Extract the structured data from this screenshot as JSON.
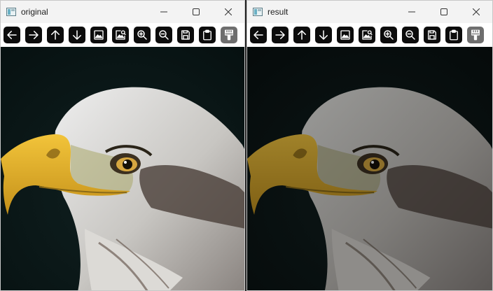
{
  "windows": [
    {
      "title": "original",
      "filter": "none",
      "controls": [
        "minimize-icon",
        "maximize-icon",
        "close-icon"
      ],
      "toolbar": [
        {
          "name": "back-button",
          "icon": "arrow-left-icon"
        },
        {
          "name": "forward-button",
          "icon": "arrow-right-icon"
        },
        {
          "name": "up-button",
          "icon": "arrow-up-icon"
        },
        {
          "name": "down-button",
          "icon": "arrow-down-icon"
        },
        {
          "name": "image-button",
          "icon": "image-icon"
        },
        {
          "name": "image-zoom-button",
          "icon": "image-search-icon"
        },
        {
          "name": "zoom-in-button",
          "icon": "zoom-in-icon"
        },
        {
          "name": "zoom-out-button",
          "icon": "zoom-out-icon"
        },
        {
          "name": "save-button",
          "icon": "save-icon"
        },
        {
          "name": "clipboard-button",
          "icon": "clipboard-icon"
        },
        {
          "name": "properties-button",
          "icon": "brush-icon",
          "selected": true
        }
      ]
    },
    {
      "title": "result",
      "filter": "dim",
      "controls": [
        "minimize-icon",
        "maximize-icon",
        "close-icon"
      ],
      "toolbar": [
        {
          "name": "back-button",
          "icon": "arrow-left-icon"
        },
        {
          "name": "forward-button",
          "icon": "arrow-right-icon"
        },
        {
          "name": "up-button",
          "icon": "arrow-up-icon"
        },
        {
          "name": "down-button",
          "icon": "arrow-down-icon"
        },
        {
          "name": "image-button",
          "icon": "image-icon"
        },
        {
          "name": "image-zoom-button",
          "icon": "image-search-icon"
        },
        {
          "name": "zoom-in-button",
          "icon": "zoom-in-icon"
        },
        {
          "name": "zoom-out-button",
          "icon": "zoom-out-icon"
        },
        {
          "name": "save-button",
          "icon": "save-icon"
        },
        {
          "name": "clipboard-button",
          "icon": "clipboard-icon"
        },
        {
          "name": "properties-button",
          "icon": "brush-icon",
          "selected": true
        }
      ]
    }
  ],
  "colors": {
    "toolbar_button_bg": "#0c0c0c",
    "toolbar_button_selected_bg": "#6e6e6e",
    "titlebar_bg": "#f3f3f3",
    "image_background": "#0a1212"
  }
}
